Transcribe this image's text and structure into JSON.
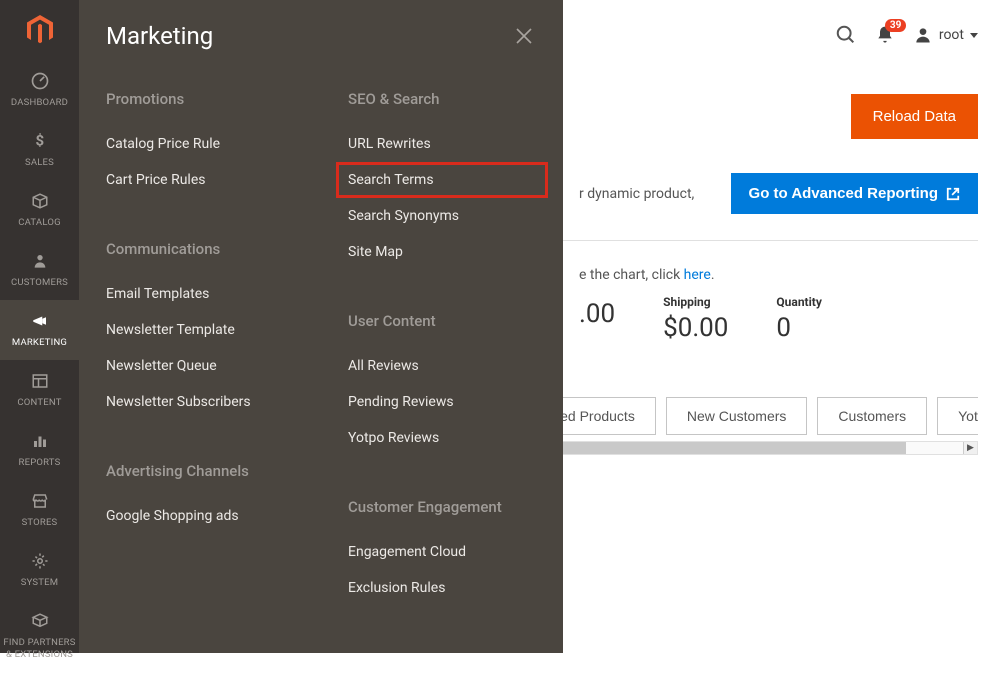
{
  "sidebar": {
    "items": [
      {
        "label": "DASHBOARD"
      },
      {
        "label": "SALES"
      },
      {
        "label": "CATALOG"
      },
      {
        "label": "CUSTOMERS"
      },
      {
        "label": "MARKETING"
      },
      {
        "label": "CONTENT"
      },
      {
        "label": "REPORTS"
      },
      {
        "label": "STORES"
      },
      {
        "label": "SYSTEM"
      },
      {
        "label": "FIND PARTNERS"
      },
      {
        "label_line2": "& EXTENSIONS"
      }
    ]
  },
  "flyout": {
    "title": "Marketing",
    "col1": {
      "g1_title": "Promotions",
      "g1_links": [
        "Catalog Price Rule",
        "Cart Price Rules"
      ],
      "g2_title": "Communications",
      "g2_links": [
        "Email Templates",
        "Newsletter Template",
        "Newsletter Queue",
        "Newsletter Subscribers"
      ],
      "g3_title": "Advertising Channels",
      "g3_links": [
        "Google Shopping ads"
      ]
    },
    "col2": {
      "g1_title": "SEO & Search",
      "g1_links": [
        "URL Rewrites",
        "Search Terms",
        "Search Synonyms",
        "Site Map"
      ],
      "g2_title": "User Content",
      "g2_links": [
        "All Reviews",
        "Pending Reviews",
        "Yotpo Reviews"
      ],
      "g3_title": "Customer Engagement",
      "g3_links": [
        "Engagement Cloud",
        "Exclusion Rules"
      ]
    }
  },
  "topbar": {
    "badge": "39",
    "user": "root"
  },
  "main": {
    "reload_btn": "Reload Data",
    "adv_text_fragment": "r dynamic product,",
    "adv_btn": "Go to Advanced Reporting",
    "chart_note_pre": "e the chart, click ",
    "chart_note_link": "here",
    "chart_note_post": ".",
    "stats": [
      {
        "label": "",
        "val": ".00"
      },
      {
        "label": "Shipping",
        "val": "$0.00"
      },
      {
        "label": "Quantity",
        "val": "0"
      }
    ],
    "tabs": [
      "wed Products",
      "New Customers",
      "Customers",
      "Yotp"
    ]
  }
}
